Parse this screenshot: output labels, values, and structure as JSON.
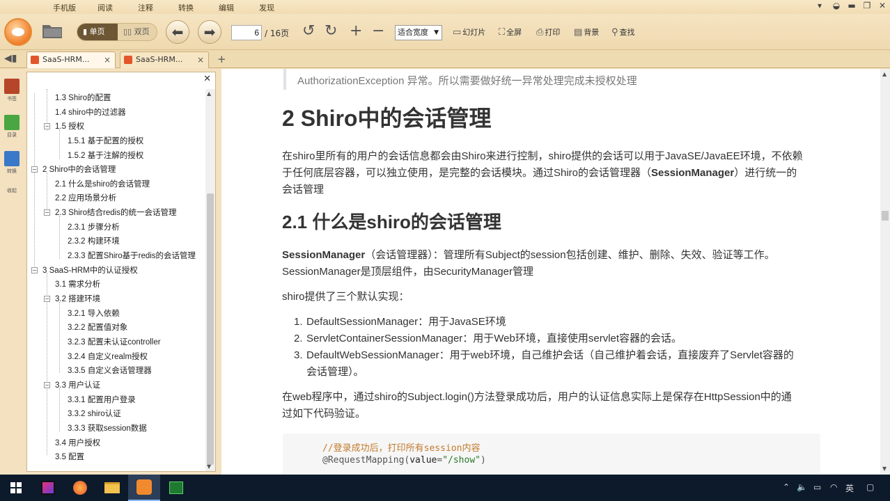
{
  "menu": [
    "手机版",
    "阅读",
    "注释",
    "转换",
    "编辑",
    "发现"
  ],
  "toolbar": {
    "view_single": "单页",
    "view_double": "双页",
    "page_current": "6",
    "page_total": "/ 16页",
    "zoom": "适合宽度",
    "slideshow": "幻灯片",
    "fullscreen": "全屏",
    "print": "打印",
    "background": "背景",
    "find": "查找"
  },
  "tabs": [
    {
      "label": "SaaS-HRM..."
    },
    {
      "label": "SaaS-HRM..."
    }
  ],
  "leftstrip": {
    "bookmarks": "书签",
    "outline": "目录",
    "convert": "转换",
    "collapse": "收起"
  },
  "outline": [
    {
      "text": "1.3 Shiro的配置"
    },
    {
      "text": "1.4 shiro中的过滤器"
    },
    {
      "text": "1.5 授权",
      "toggle": "−"
    },
    {
      "text": "1.5.1 基于配置的授权"
    },
    {
      "text": "1.5.2 基于注解的授权"
    },
    {
      "text": "2 Shiro中的会话管理",
      "toggle": "−"
    },
    {
      "text": "2.1 什么是shiro的会话管理"
    },
    {
      "text": "2.2 应用场景分析"
    },
    {
      "text": "2.3 Shiro结合redis的统一会话管理",
      "toggle": "−"
    },
    {
      "text": "2.3.1 步骤分析"
    },
    {
      "text": "2.3.2 构建环境"
    },
    {
      "text": "2.3.3 配置Shiro基于redis的会话管理"
    },
    {
      "text": "3 SaaS-HRM中的认证授权",
      "toggle": "−"
    },
    {
      "text": "3.1 需求分析"
    },
    {
      "text": "3.2 搭建环境",
      "toggle": "−"
    },
    {
      "text": "3.2.1 导入依赖"
    },
    {
      "text": "3.2.2 配置值对象"
    },
    {
      "text": "3.2.3 配置未认证controller"
    },
    {
      "text": "3.2.4 自定义realm授权"
    },
    {
      "text": "3.3.5 自定义会话管理器"
    },
    {
      "text": "3.3 用户认证",
      "toggle": "−"
    },
    {
      "text": "3.3.1 配置用户登录"
    },
    {
      "text": "3.3.2 shiro认证"
    },
    {
      "text": "3.3.3 获取session数据"
    },
    {
      "text": "3.4 用户授权"
    },
    {
      "text": "3.5 配置"
    }
  ],
  "doc": {
    "quote_tail": "AuthorizationException 异常。所以需要做好统一异常处理完成未授权处理",
    "h1": "2 Shiro中的会话管理",
    "p1_line1": "在shiro里所有的用户的会话信息都会由Shiro来进行控制，shiro提供的会话可以用于JavaSE/JavaEE环境，不依赖",
    "p1_line2a": "于任何底层容器，可以独立使用，是完整的会话模块。通过Shiro的会话管理器（",
    "p1_line2b": "SessionManager",
    "p1_line2c": "）进行统一的",
    "p1_line3": "会话管理",
    "h2": "2.1 什么是shiro的会话管理",
    "p2_bold": "SessionManager",
    "p2_line1": "（会话管理器）：管理所有Subject的session包括创建、维护、删除、失效、验证等工作。",
    "p2_line2": "SessionManager是顶层组件，由SecurityManager管理",
    "p3": "shiro提供了三个默认实现：",
    "list": [
      {
        "num": "1.",
        "line1": "DefaultSessionManager：用于JavaSE环境"
      },
      {
        "num": "2.",
        "line1": "ServletContainerSessionManager：用于Web环境，直接使用servlet容器的会话。"
      },
      {
        "num": "3.",
        "line1": "DefaultWebSessionManager：用于web环境，自己维护会话（自己维护着会话，直接废弃了Servlet容器的",
        "line2": "会话管理）。"
      }
    ],
    "p4_line1": "在web程序中，通过shiro的Subject.login()方法登录成功后，用户的认证信息实际上是保存在HttpSession中的通",
    "p4_line2": "过如下代码验证。",
    "code_comment": "//登录成功后，打印所有session内容",
    "code_line2_a": "@RequestMapping(",
    "code_line2_b": "value",
    "code_line2_c": "=",
    "code_line2_d": "\"/show\"",
    "code_line2_e": ")"
  },
  "taskbar": {
    "ime": "英"
  },
  "colors": {
    "accent": "#6d5634",
    "code_comment": "#c27a2c",
    "code_string": "#2a7a2a",
    "heading": "#222222"
  }
}
